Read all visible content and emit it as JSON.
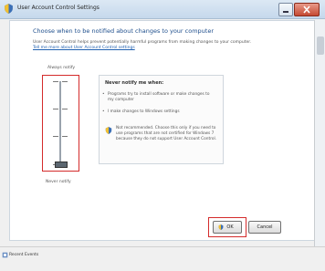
{
  "window": {
    "title": "User Account Control Settings"
  },
  "main": {
    "heading": "Choose when to be notified about changes to your computer",
    "description": "User Account Control helps prevent potentially harmful programs from making changes to your computer.",
    "link": "Tell me more about User Account Control settings"
  },
  "slider": {
    "top_label": "Always notify",
    "bottom_label": "Never notify",
    "level_fraction": 0.0,
    "tick_count": 4
  },
  "info": {
    "title": "Never notify me when:",
    "bullets": [
      "Programs try to install software or make changes to my computer",
      "I make changes to Windows settings"
    ],
    "recommendation": "Not recommended. Choose this only if you need to use programs that are not certified for Windows 7 because they do not support User Account Control."
  },
  "buttons": {
    "ok": "OK",
    "cancel": "Cancel"
  },
  "taskbar": {
    "item_label": "Recent Events"
  },
  "colors": {
    "heading": "#1e4e8c",
    "highlight": "#d42b2b",
    "link": "#2060b0"
  }
}
